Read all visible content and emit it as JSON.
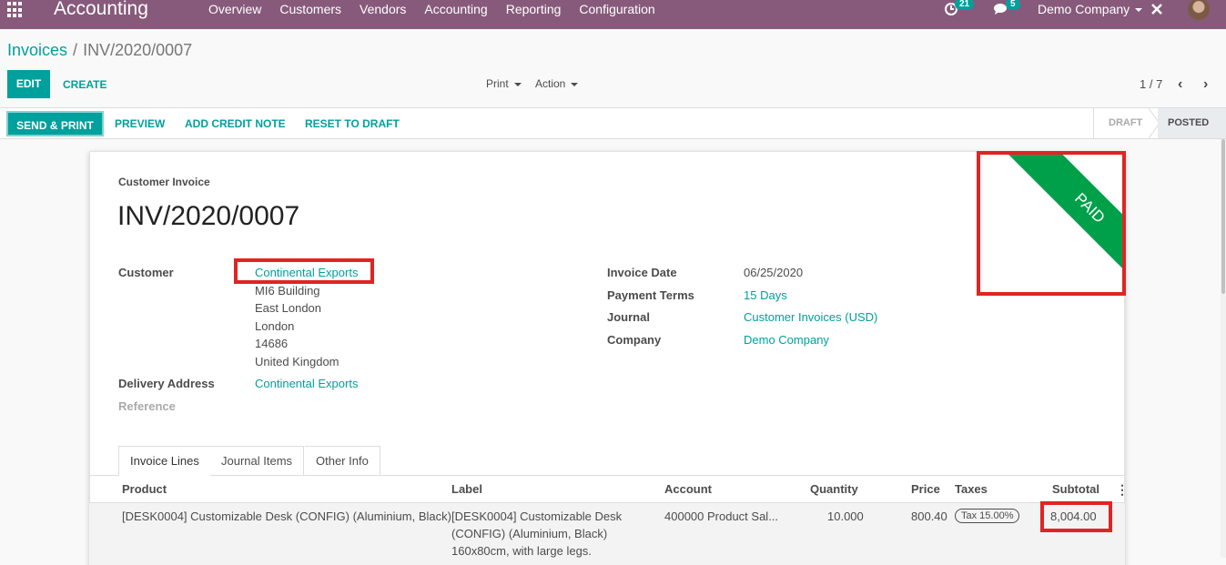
{
  "nav": {
    "brand": "Accounting",
    "menu": [
      "Overview",
      "Customers",
      "Vendors",
      "Accounting",
      "Reporting",
      "Configuration"
    ],
    "activity_count": "21",
    "message_count": "5",
    "company": "Demo Company"
  },
  "breadcrumb": {
    "parent": "Invoices",
    "separator": "/",
    "current": "INV/2020/0007"
  },
  "control": {
    "edit": "EDIT",
    "create": "CREATE",
    "print": "Print",
    "action": "Action",
    "pager": "1 / 7"
  },
  "statusbar": {
    "send_print": "SEND & PRINT",
    "preview": "PREVIEW",
    "add_credit_note": "ADD CREDIT NOTE",
    "reset_to_draft": "RESET TO DRAFT",
    "stages": [
      "DRAFT",
      "POSTED"
    ],
    "active_stage": "POSTED"
  },
  "invoice": {
    "type_label": "Customer Invoice",
    "number": "INV/2020/0007",
    "ribbon": "PAID",
    "customer_label": "Customer",
    "customer": "Continental Exports",
    "address": [
      "MI6 Building",
      "East London",
      "London",
      "14686",
      "United Kingdom"
    ],
    "delivery_label": "Delivery Address",
    "delivery": "Continental Exports",
    "reference_label": "Reference",
    "invoice_date_label": "Invoice Date",
    "invoice_date": "06/25/2020",
    "payment_terms_label": "Payment Terms",
    "payment_terms": "15 Days",
    "journal_label": "Journal",
    "journal": "Customer Invoices (USD)",
    "company_label": "Company",
    "company": "Demo Company"
  },
  "tabs": [
    "Invoice Lines",
    "Journal Items",
    "Other Info"
  ],
  "lines": {
    "headers": [
      "Product",
      "Label",
      "Account",
      "Quantity",
      "Price",
      "Taxes",
      "Subtotal"
    ],
    "row": {
      "product": "[DESK0004] Customizable Desk (CONFIG) (Aluminium, Black)",
      "label_lines": [
        "[DESK0004] Customizable Desk",
        "(CONFIG) (Aluminium, Black)",
        "160x80cm, with large legs."
      ],
      "account": "400000 Product Sal...",
      "quantity": "10.000",
      "price": "800.40",
      "tax": "Tax 15.00%",
      "subtotal": "8,004.00"
    }
  },
  "colors": {
    "navbar": "#875a7b",
    "accent": "#00a09d",
    "paid_ribbon": "#00a04a",
    "highlight": "#e02424"
  }
}
